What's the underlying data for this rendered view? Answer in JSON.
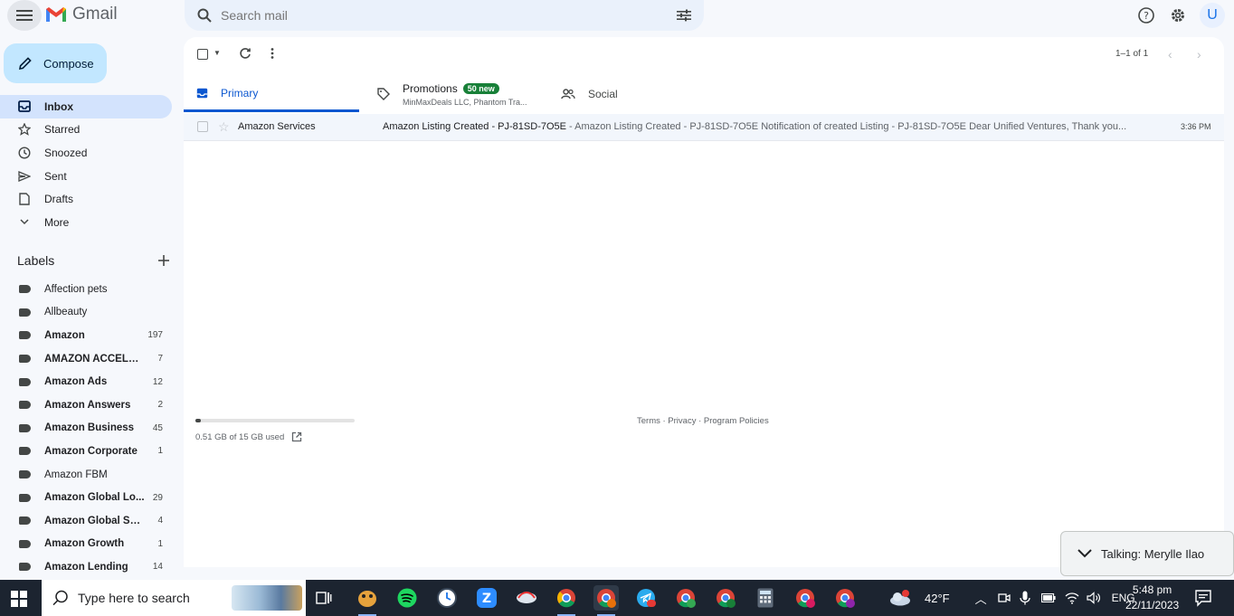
{
  "header": {
    "app_name": "Gmail",
    "search_placeholder": "Search mail",
    "avatar_initial": "U"
  },
  "sidebar": {
    "compose_label": "Compose",
    "nav": [
      {
        "label": "Inbox",
        "icon": "inbox-icon",
        "active": true
      },
      {
        "label": "Starred",
        "icon": "star-icon"
      },
      {
        "label": "Snoozed",
        "icon": "clock-icon"
      },
      {
        "label": "Sent",
        "icon": "send-icon"
      },
      {
        "label": "Drafts",
        "icon": "draft-icon"
      },
      {
        "label": "More",
        "icon": "chevron-down-icon"
      }
    ],
    "labels_title": "Labels",
    "labels": [
      {
        "name": "Affection pets",
        "count": "",
        "bold": false
      },
      {
        "name": "Allbeauty",
        "count": "",
        "bold": false
      },
      {
        "name": "Amazon",
        "count": "197",
        "bold": true
      },
      {
        "name": "AMAZON ACCELER...",
        "count": "7",
        "bold": true
      },
      {
        "name": "Amazon Ads",
        "count": "12",
        "bold": true
      },
      {
        "name": "Amazon Answers",
        "count": "2",
        "bold": true
      },
      {
        "name": "Amazon Business",
        "count": "45",
        "bold": true
      },
      {
        "name": "Amazon Corporate",
        "count": "1",
        "bold": true
      },
      {
        "name": "Amazon FBM",
        "count": "",
        "bold": false
      },
      {
        "name": "Amazon Global Lo...",
        "count": "29",
        "bold": true
      },
      {
        "name": "Amazon Global Sell...",
        "count": "4",
        "bold": true
      },
      {
        "name": "Amazon Growth",
        "count": "1",
        "bold": true
      },
      {
        "name": "Amazon Lending",
        "count": "14",
        "bold": true
      }
    ]
  },
  "toolbar": {
    "pager_text": "1–1 of 1"
  },
  "tabs": {
    "primary": "Primary",
    "promotions": "Promotions",
    "promotions_badge": "50 new",
    "promotions_sub": "MinMaxDeals LLC, Phantom Tra...",
    "social": "Social"
  },
  "emails": [
    {
      "sender": "Amazon Services",
      "subject": "Amazon Listing Created - PJ-81SD-7O5E",
      "snippet": " - Amazon Listing Created - PJ-81SD-7O5E Notification of created Listing - PJ-81SD-7O5E Dear Unified Ventures, Thank you...",
      "time": "3:36 PM"
    }
  ],
  "storage": {
    "text": "0.51 GB of 15 GB used",
    "fraction": 0.034
  },
  "footer": {
    "links": "Terms · Privacy · Program Policies"
  },
  "toast": {
    "text": "Talking: Merylle Ilao"
  },
  "taskbar": {
    "search_placeholder": "Type here to search",
    "weather": "42°F",
    "weather_badge": "1",
    "language": "ENG",
    "time": "5:48 pm",
    "date": "22/11/2023",
    "telegram_badge": "81",
    "chrome_profiles": [
      "M",
      "M",
      "L",
      "S",
      "R"
    ]
  },
  "colors": {
    "accent": "#0b57d0",
    "compose_bg": "#c2e7ff",
    "active_nav": "#d3e3fd",
    "badge_green": "#188038"
  }
}
